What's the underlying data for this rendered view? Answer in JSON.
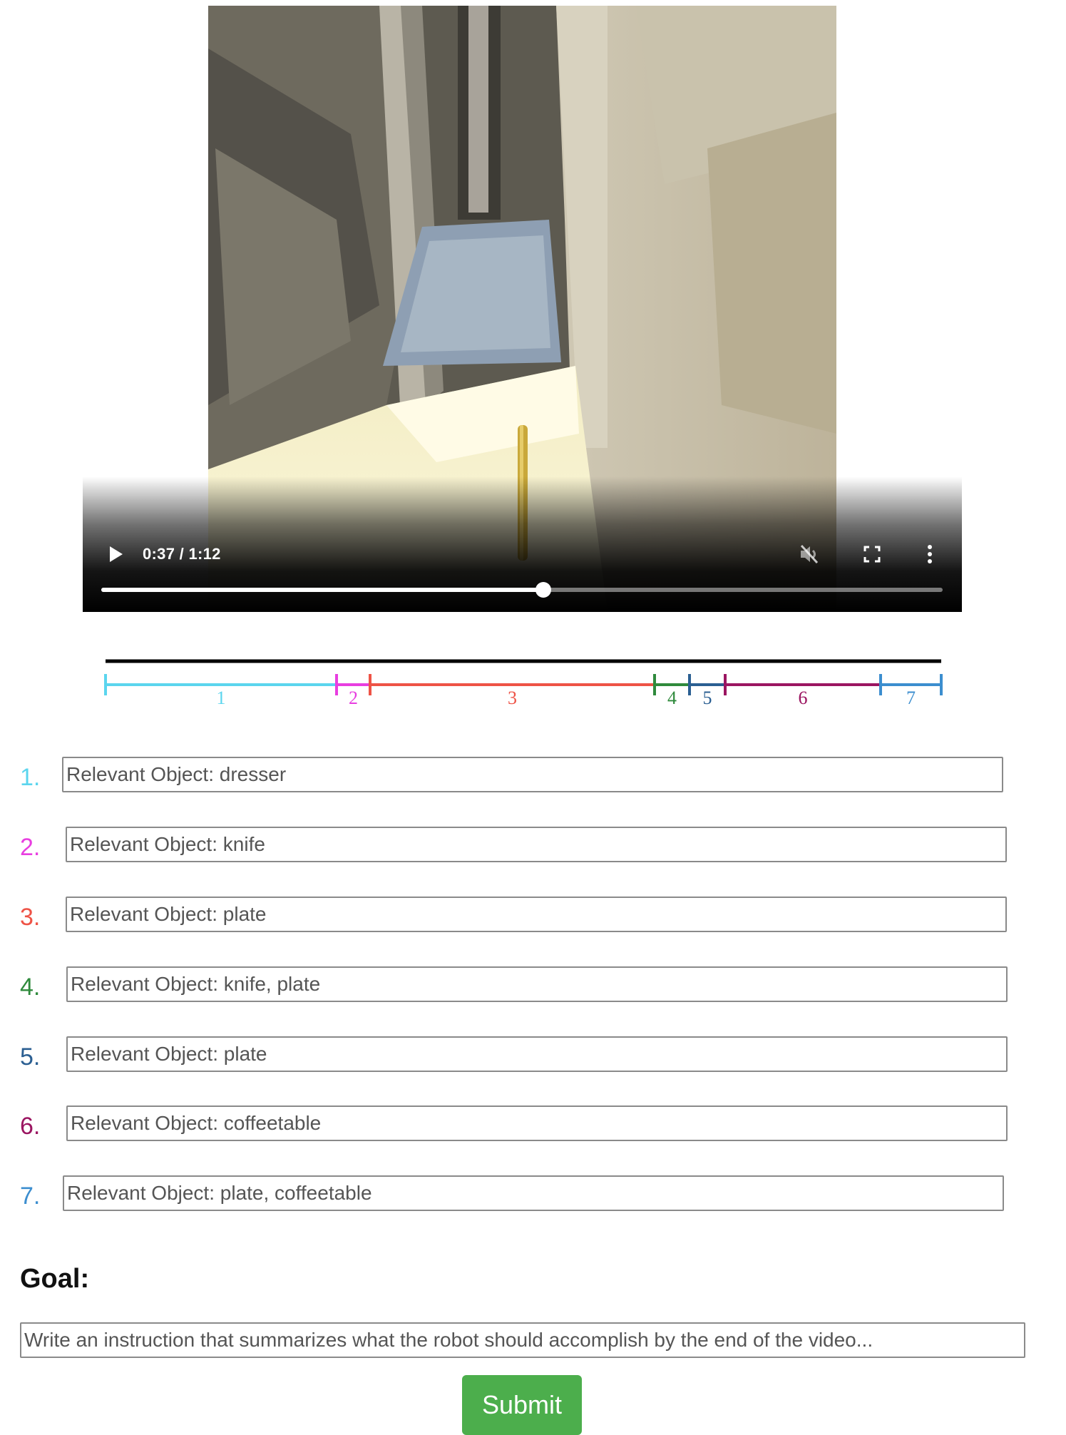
{
  "video": {
    "time_display": "0:37 / 1:12",
    "progress_fraction": 0.525,
    "icons": {
      "play": "play-icon",
      "mute": "muted-volume-icon",
      "fullscreen": "fullscreen-icon",
      "more": "more-vertical-icon"
    }
  },
  "timeline": {
    "top_bar_color": "#000000",
    "segments": [
      {
        "label": "1",
        "color": "#5bd5ee"
      },
      {
        "label": "2",
        "color": "#e83ee0"
      },
      {
        "label": "3",
        "color": "#ee5346"
      },
      {
        "label": "4",
        "color": "#2f8a3c"
      },
      {
        "label": "5",
        "color": "#2b5f92"
      },
      {
        "label": "6",
        "color": "#9b1561"
      },
      {
        "label": "7",
        "color": "#3c8ecf"
      }
    ]
  },
  "steps": [
    {
      "number": "1.",
      "value": "Relevant Object: dresser",
      "color": "#5bd5ee"
    },
    {
      "number": "2.",
      "value": "Relevant Object: knife",
      "color": "#e83ee0"
    },
    {
      "number": "3.",
      "value": "Relevant Object: plate",
      "color": "#ee5346"
    },
    {
      "number": "4.",
      "value": "Relevant Object: knife, plate",
      "color": "#2f8a3c"
    },
    {
      "number": "5.",
      "value": "Relevant Object: plate",
      "color": "#2b5f92"
    },
    {
      "number": "6.",
      "value": "Relevant Object: coffeetable",
      "color": "#9b1561"
    },
    {
      "number": "7.",
      "value": "Relevant Object: plate, coffeetable",
      "color": "#3c8ecf"
    }
  ],
  "goal": {
    "title": "Goal:",
    "placeholder": "Write an instruction that summarizes what the robot should accomplish by the end of the video..."
  },
  "submit_label": "Submit",
  "accent_color": "#4cae4c"
}
